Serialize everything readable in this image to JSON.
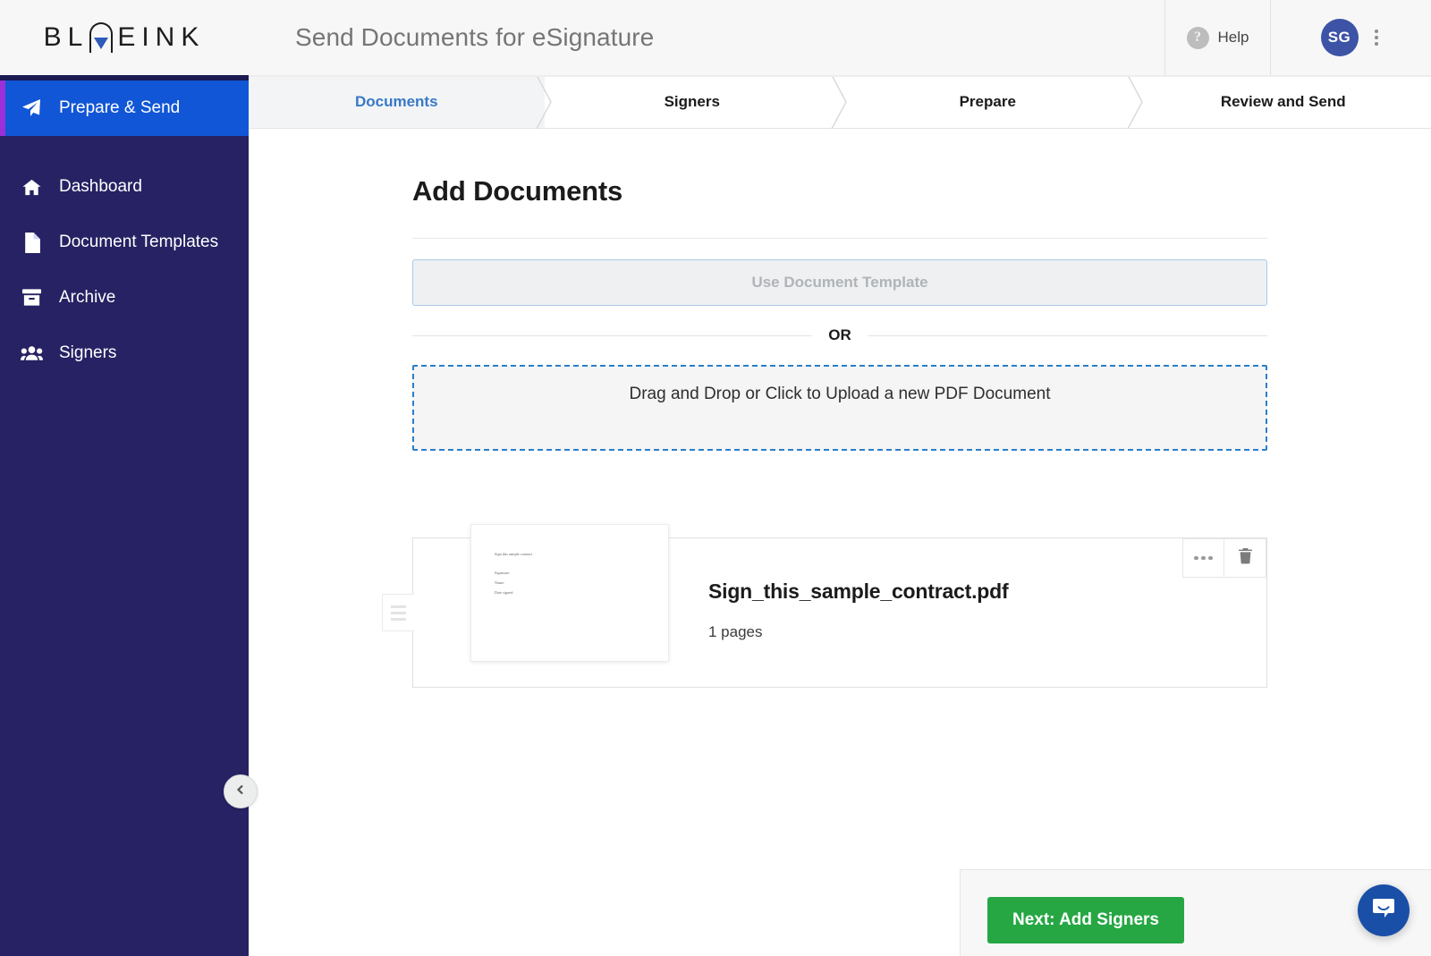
{
  "app": {
    "logo_before": "BL",
    "logo_after": "EINK",
    "title": "Send Documents for eSignature"
  },
  "header": {
    "help_label": "Help",
    "help_icon": "question-circle-icon",
    "avatar_initials": "SG",
    "kebab_icon": "vertical-dots-icon"
  },
  "sidebar": {
    "items": [
      {
        "label": "Prepare & Send",
        "icon": "paper-plane-icon",
        "active": true
      },
      {
        "label": "Dashboard",
        "icon": "home-icon",
        "active": false
      },
      {
        "label": "Document Templates",
        "icon": "file-icon",
        "active": false
      },
      {
        "label": "Archive",
        "icon": "archive-box-icon",
        "active": false
      },
      {
        "label": "Signers",
        "icon": "users-icon",
        "active": false
      }
    ],
    "collapse_icon": "chevron-left-icon"
  },
  "steps": [
    {
      "label": "Documents",
      "active": true
    },
    {
      "label": "Signers",
      "active": false
    },
    {
      "label": "Prepare",
      "active": false
    },
    {
      "label": "Review and Send",
      "active": false
    }
  ],
  "main": {
    "page_title": "Add Documents",
    "template_button": "Use Document Template",
    "or_label": "OR",
    "dropzone_label": "Drag and Drop or Click to Upload a new PDF Document"
  },
  "document": {
    "name": "Sign_this_sample_contract.pdf",
    "pages": "1 pages",
    "drag_handle_icon": "drag-handle-icon",
    "more_icon": "ellipsis-icon",
    "delete_icon": "trash-icon",
    "thumbnail_lines": [
      "Sign this sample contract",
      "Signature:",
      "Name:",
      "Date signed:"
    ]
  },
  "footer": {
    "next_label": "Next: Add Signers",
    "chat_icon": "intercom-chat-icon"
  },
  "colors": {
    "sidebar_bg": "#262263",
    "sidebar_active": "#1156d6",
    "sidebar_accent": "#9b30d9",
    "tab_active_text": "#3879c6",
    "dropzone_border": "#2a7fc9",
    "next_button": "#26a744",
    "avatar_bg": "#3c53a6",
    "chat_bg": "#1a4fa8"
  }
}
